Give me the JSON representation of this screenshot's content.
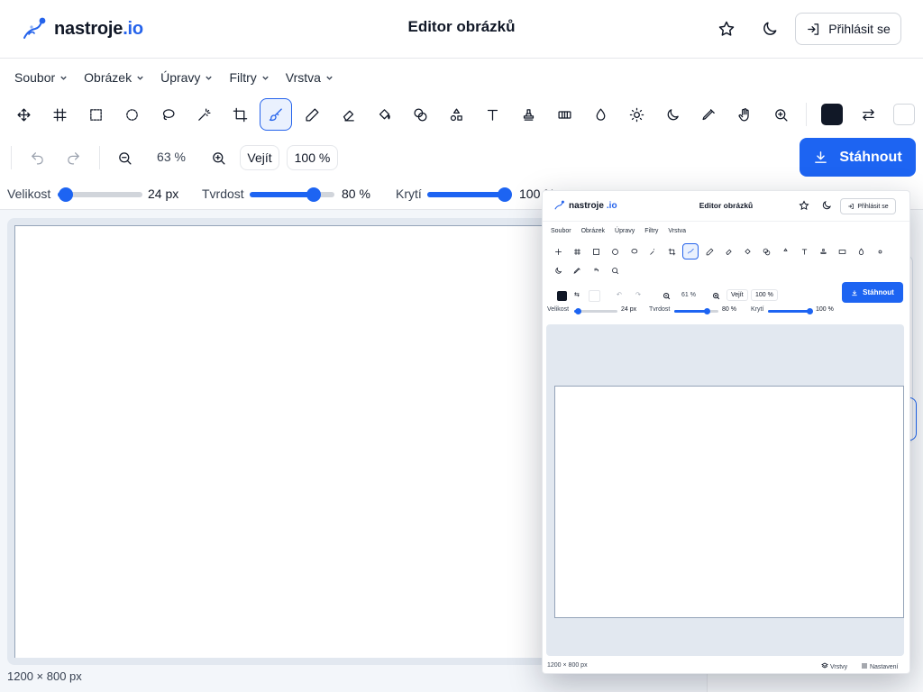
{
  "header": {
    "logo_main": "nastroje",
    "logo_accent": ".io",
    "title": "Editor obrázků",
    "login_label": "Přihlásit se",
    "icons": [
      "star-icon",
      "moon-icon",
      "login-icon"
    ]
  },
  "menu": [
    {
      "label": "Soubor"
    },
    {
      "label": "Obrázek"
    },
    {
      "label": "Úpravy"
    },
    {
      "label": "Filtry"
    },
    {
      "label": "Vrstva"
    }
  ],
  "tools": {
    "items": [
      "move",
      "crop-frame",
      "rect-select",
      "ellipse-select",
      "lasso",
      "magic-wand",
      "crop",
      "brush",
      "pencil",
      "eraser",
      "fill-bucket",
      "shapes",
      "shapes-triangle",
      "text",
      "stamp",
      "gradient",
      "blur",
      "brightness",
      "dodge",
      "eyedropper",
      "hand",
      "zoom"
    ],
    "active": "brush",
    "foreground_color": "#111827",
    "background_color": "#ffffff"
  },
  "zoom": {
    "value": "63 %",
    "fit_label": "Vejít",
    "actual_label": "100 %"
  },
  "download_label": "Stáhnout",
  "sliders": [
    {
      "label": "Velikost",
      "value_text": "24 px",
      "fraction": 0.1
    },
    {
      "label": "Tvrdost",
      "value_text": "80 %",
      "fraction": 0.75
    },
    {
      "label": "Krytí",
      "value_text": "100 %",
      "fraction": 0.92
    }
  ],
  "canvas": {
    "size_text": "1200 × 800 px"
  },
  "preview": {
    "logo_main": "nastroje",
    "logo_accent": ".io",
    "title": "Editor obrázků",
    "login_label": "Přihlásit se",
    "menu": [
      "Soubor",
      "Obrázek",
      "Úpravy",
      "Filtry",
      "Vrstva"
    ],
    "zoom_value": "61 %",
    "fit_label": "Vejít",
    "actual_label": "100 %",
    "download_label": "Stáhnout",
    "sliders": [
      {
        "label": "Velikost",
        "value_text": "24 px",
        "fraction": 0.1
      },
      {
        "label": "Tvrdost",
        "value_text": "80 %",
        "fraction": 0.75
      },
      {
        "label": "Krytí",
        "value_text": "100 %",
        "fraction": 0.95
      }
    ],
    "size_text": "1200 × 800 px",
    "layers_label": "Vrstvy",
    "settings_label": "Nastavení"
  }
}
